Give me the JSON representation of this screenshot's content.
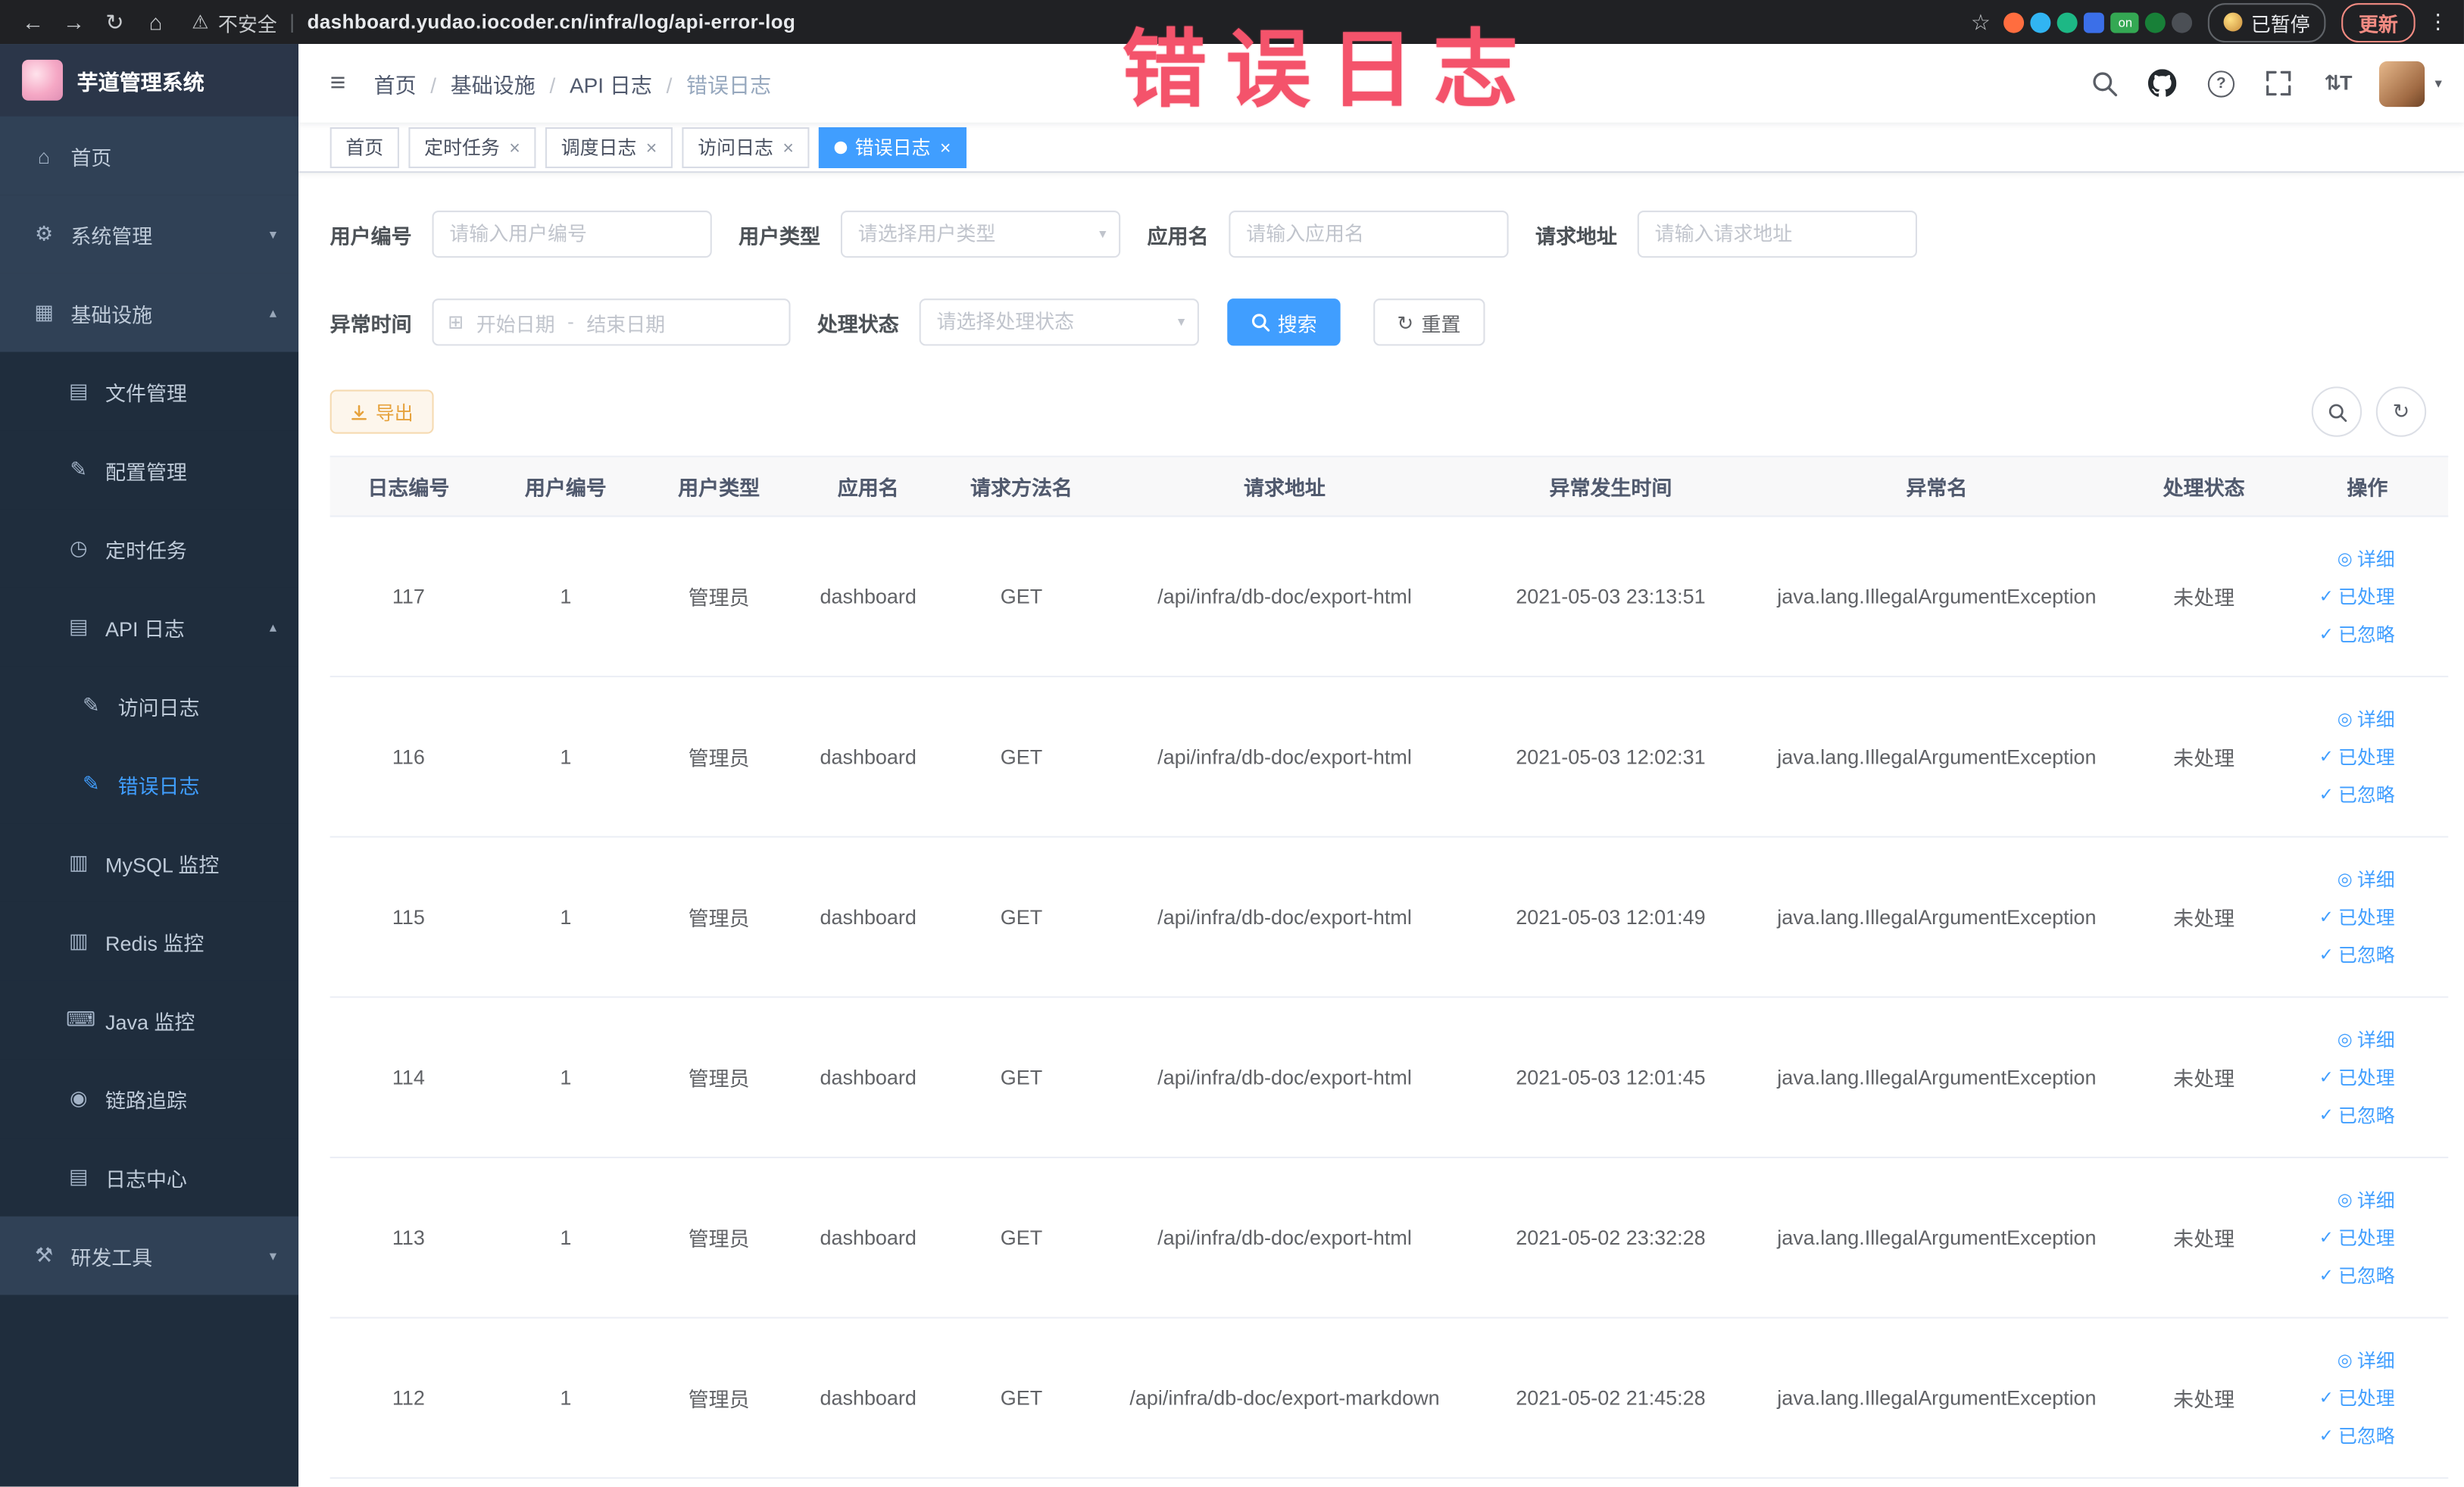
{
  "annotation": {
    "text": "错误日志"
  },
  "icons": {
    "back": "←",
    "forward": "→",
    "reload": "↻",
    "home": "⌂",
    "warning": "⚠",
    "star": "☆",
    "kebab": "⋮",
    "hamburger": "≡",
    "question": "?",
    "fontsize": "⇅T",
    "caret_down": "▾",
    "close": "×",
    "calendar": "⊞",
    "refresh": "↻",
    "eye": "◎",
    "check": "✓",
    "chevron_down": "▾",
    "gear": "⚙"
  },
  "browser": {
    "security_label": "不安全",
    "url": "dashboard.yudao.iocoder.cn/infra/log/api-error-log",
    "paused_badge": "已暂停",
    "update_label": "更新",
    "extension_badge_on": "on"
  },
  "sidebar": {
    "logo_title": "芋道管理系统",
    "items": [
      {
        "label": "首页",
        "icon": "home-icon",
        "glyph": "⌂",
        "level": 0
      },
      {
        "label": "系统管理",
        "icon": "gear-icon",
        "glyph": "⚙",
        "level": 0,
        "chevron": "down"
      },
      {
        "label": "基础设施",
        "icon": "infrastructure-icon",
        "glyph": "▦",
        "level": 0,
        "chevron": "up"
      },
      {
        "label": "文件管理",
        "icon": "file-manage-icon",
        "glyph": "▤",
        "level": 1
      },
      {
        "label": "配置管理",
        "icon": "config-icon",
        "glyph": "✎",
        "level": 1
      },
      {
        "label": "定时任务",
        "icon": "timer-icon",
        "glyph": "◷",
        "level": 1
      },
      {
        "label": "API 日志",
        "icon": "api-log-icon",
        "glyph": "▤",
        "level": 1,
        "chevron": "up"
      },
      {
        "label": "访问日志",
        "icon": "access-log-icon",
        "glyph": "✎",
        "level": 2
      },
      {
        "label": "错误日志",
        "icon": "error-log-icon",
        "glyph": "✎",
        "level": 2,
        "active": true
      },
      {
        "label": "MySQL 监控",
        "icon": "mysql-monitor-icon",
        "glyph": "▥",
        "level": 1
      },
      {
        "label": "Redis 监控",
        "icon": "redis-monitor-icon",
        "glyph": "▥",
        "level": 1
      },
      {
        "label": "Java 监控",
        "icon": "java-monitor-icon",
        "glyph": "⌨",
        "level": 1
      },
      {
        "label": "链路追踪",
        "icon": "trace-icon",
        "glyph": "◉",
        "level": 1
      },
      {
        "label": "日志中心",
        "icon": "log-center-icon",
        "glyph": "▤",
        "level": 1
      },
      {
        "label": "研发工具",
        "icon": "dev-tools-icon",
        "glyph": "⚒",
        "level": 0,
        "chevron": "down"
      }
    ]
  },
  "header": {
    "breadcrumb": [
      {
        "label": "首页"
      },
      {
        "label": "基础设施"
      },
      {
        "label": "API 日志"
      },
      {
        "label": "错误日志",
        "current": true
      }
    ]
  },
  "tabs": [
    {
      "label": "首页"
    },
    {
      "label": "定时任务",
      "closable": true
    },
    {
      "label": "调度日志",
      "closable": true
    },
    {
      "label": "访问日志",
      "closable": true
    },
    {
      "label": "错误日志",
      "closable": true,
      "active": true
    }
  ],
  "filters": {
    "user_id": {
      "label": "用户编号",
      "placeholder": "请输入用户编号"
    },
    "user_type": {
      "label": "用户类型",
      "placeholder": "请选择用户类型"
    },
    "app_name": {
      "label": "应用名",
      "placeholder": "请输入应用名"
    },
    "request_url": {
      "label": "请求地址",
      "placeholder": "请输入请求地址"
    },
    "exception_time": {
      "label": "异常时间",
      "start_placeholder": "开始日期",
      "separator": "-",
      "end_placeholder": "结束日期"
    },
    "process_status": {
      "label": "处理状态",
      "placeholder": "请选择处理状态"
    },
    "search_label": "搜索",
    "reset_label": "重置"
  },
  "toolbar": {
    "export_label": "导出"
  },
  "table": {
    "columns": [
      "日志编号",
      "用户编号",
      "用户类型",
      "应用名",
      "请求方法名",
      "请求地址",
      "异常发生时间",
      "异常名",
      "处理状态",
      "操作"
    ],
    "actions": {
      "detail": "详细",
      "processed": "已处理",
      "ignored": "已忽略"
    },
    "rows": [
      {
        "id": "117",
        "user_id": "1",
        "user_type": "管理员",
        "app": "dashboard",
        "method": "GET",
        "url": "/api/infra/db-doc/export-html",
        "time": "2021-05-03 23:13:51",
        "exception": "java.lang.IllegalArgumentException",
        "status": "未处理"
      },
      {
        "id": "116",
        "user_id": "1",
        "user_type": "管理员",
        "app": "dashboard",
        "method": "GET",
        "url": "/api/infra/db-doc/export-html",
        "time": "2021-05-03 12:02:31",
        "exception": "java.lang.IllegalArgumentException",
        "status": "未处理"
      },
      {
        "id": "115",
        "user_id": "1",
        "user_type": "管理员",
        "app": "dashboard",
        "method": "GET",
        "url": "/api/infra/db-doc/export-html",
        "time": "2021-05-03 12:01:49",
        "exception": "java.lang.IllegalArgumentException",
        "status": "未处理"
      },
      {
        "id": "114",
        "user_id": "1",
        "user_type": "管理员",
        "app": "dashboard",
        "method": "GET",
        "url": "/api/infra/db-doc/export-html",
        "time": "2021-05-03 12:01:45",
        "exception": "java.lang.IllegalArgumentException",
        "status": "未处理"
      },
      {
        "id": "113",
        "user_id": "1",
        "user_type": "管理员",
        "app": "dashboard",
        "method": "GET",
        "url": "/api/infra/db-doc/export-html",
        "time": "2021-05-02 23:32:28",
        "exception": "java.lang.IllegalArgumentException",
        "status": "未处理"
      },
      {
        "id": "112",
        "user_id": "1",
        "user_type": "管理员",
        "app": "dashboard",
        "method": "GET",
        "url": "/api/infra/db-doc/export-markdown",
        "time": "2021-05-02 21:45:28",
        "exception": "java.lang.IllegalArgumentException",
        "status": "未处理"
      }
    ]
  }
}
